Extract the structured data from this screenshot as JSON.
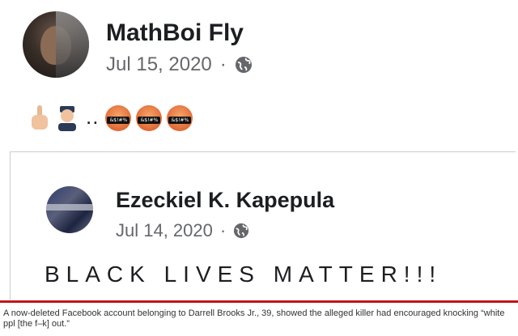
{
  "post": {
    "author": "MathBoi Fly",
    "date": "Jul 15, 2020",
    "separator": "·",
    "privacy_icon": "globe-icon",
    "emoji_text": ".."
  },
  "shared_post": {
    "author": "Ezeckiel K. Kapepula",
    "date": "Jul 14, 2020",
    "separator": "·",
    "privacy_icon": "globe-icon",
    "text": "BLACK LIVES MATTER!!!"
  },
  "caption": "A now-deleted Facebook account belonging to Darrell Brooks Jr., 39, showed the alleged killer had encouraged knocking “white ppl [the f–k] out.”",
  "emoji": {
    "first": "middle-finger-emoji",
    "second": "police-officer-emoji",
    "angry_label": "&$!#%"
  },
  "colors": {
    "caption_rule": "#c0161b",
    "meta_text": "#65676b"
  }
}
